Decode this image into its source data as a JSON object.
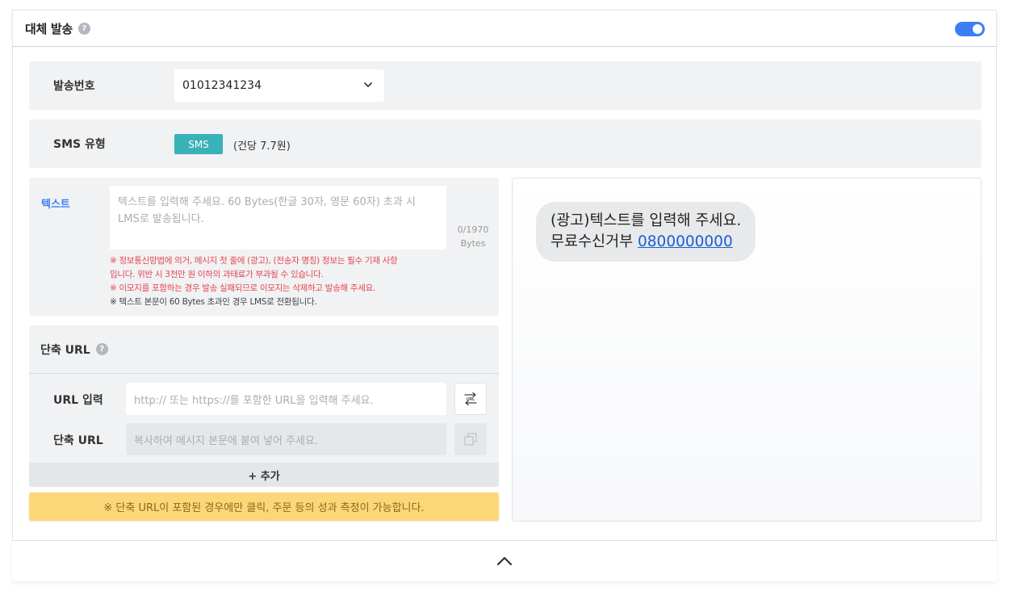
{
  "header": {
    "title": "대체 발송",
    "help": "?",
    "toggle_on": true
  },
  "sender": {
    "label": "발송번호",
    "value": "01012341234"
  },
  "sms_type": {
    "label": "SMS 유형",
    "badge": "SMS",
    "price": "(건당 7.7원)"
  },
  "text": {
    "label": "텍스트",
    "placeholder_line1": "텍스트를 입력해 주세요. 60 Bytes(한글 30자, 영문 60자) 초과 시",
    "placeholder_line2": "LMS로 발송됩니다.",
    "byte_count": "0/1970",
    "byte_unit": "Bytes",
    "notice1_line1": "※ 정보통신망법에 의거, 메시지 첫 줄에 (광고), (전송자 명칭) 정보는 필수 기재 사항",
    "notice1_line2": "입니다. 위반 시 3천만 원 이하의 과태료가 부과될 수 있습니다.",
    "notice2": "※ 이모지를 포함하는 경우 발송 실패되므로 이모지는 삭제하고 발송해 주세요.",
    "notice3": "※ 텍스트 본문이 60 Bytes 초과인 경우 LMS로 전환됩니다."
  },
  "short_url": {
    "title": "단축 URL",
    "help": "?",
    "url_input_label": "URL 입력",
    "url_input_placeholder": "http:// 또는 https://를 포함한 URL을 입력해 주세요.",
    "short_url_label": "단축 URL",
    "short_url_placeholder": "복사하여 메시지 본문에 붙여 넣어 주세요.",
    "add_label": "+ 추가"
  },
  "info_banner": "※ 단축 URL이 포함된 경우에만 클릭, 주문 등의 성과 측정이 가능합니다.",
  "preview": {
    "line1": "(광고)텍스트를 입력해 주세요.",
    "line2_prefix": "무료수신거부 ",
    "line2_number": "0800000000"
  },
  "colors": {
    "accent": "#3b7ff5",
    "sms_badge": "#38b2b8",
    "warning_text": "#e5474b",
    "banner": "#fdd677"
  },
  "icons": {
    "select": "chevron-down-icon",
    "url_convert": "url-convert-icon",
    "copy": "copy-icon",
    "collapse": "chevron-up-icon"
  }
}
